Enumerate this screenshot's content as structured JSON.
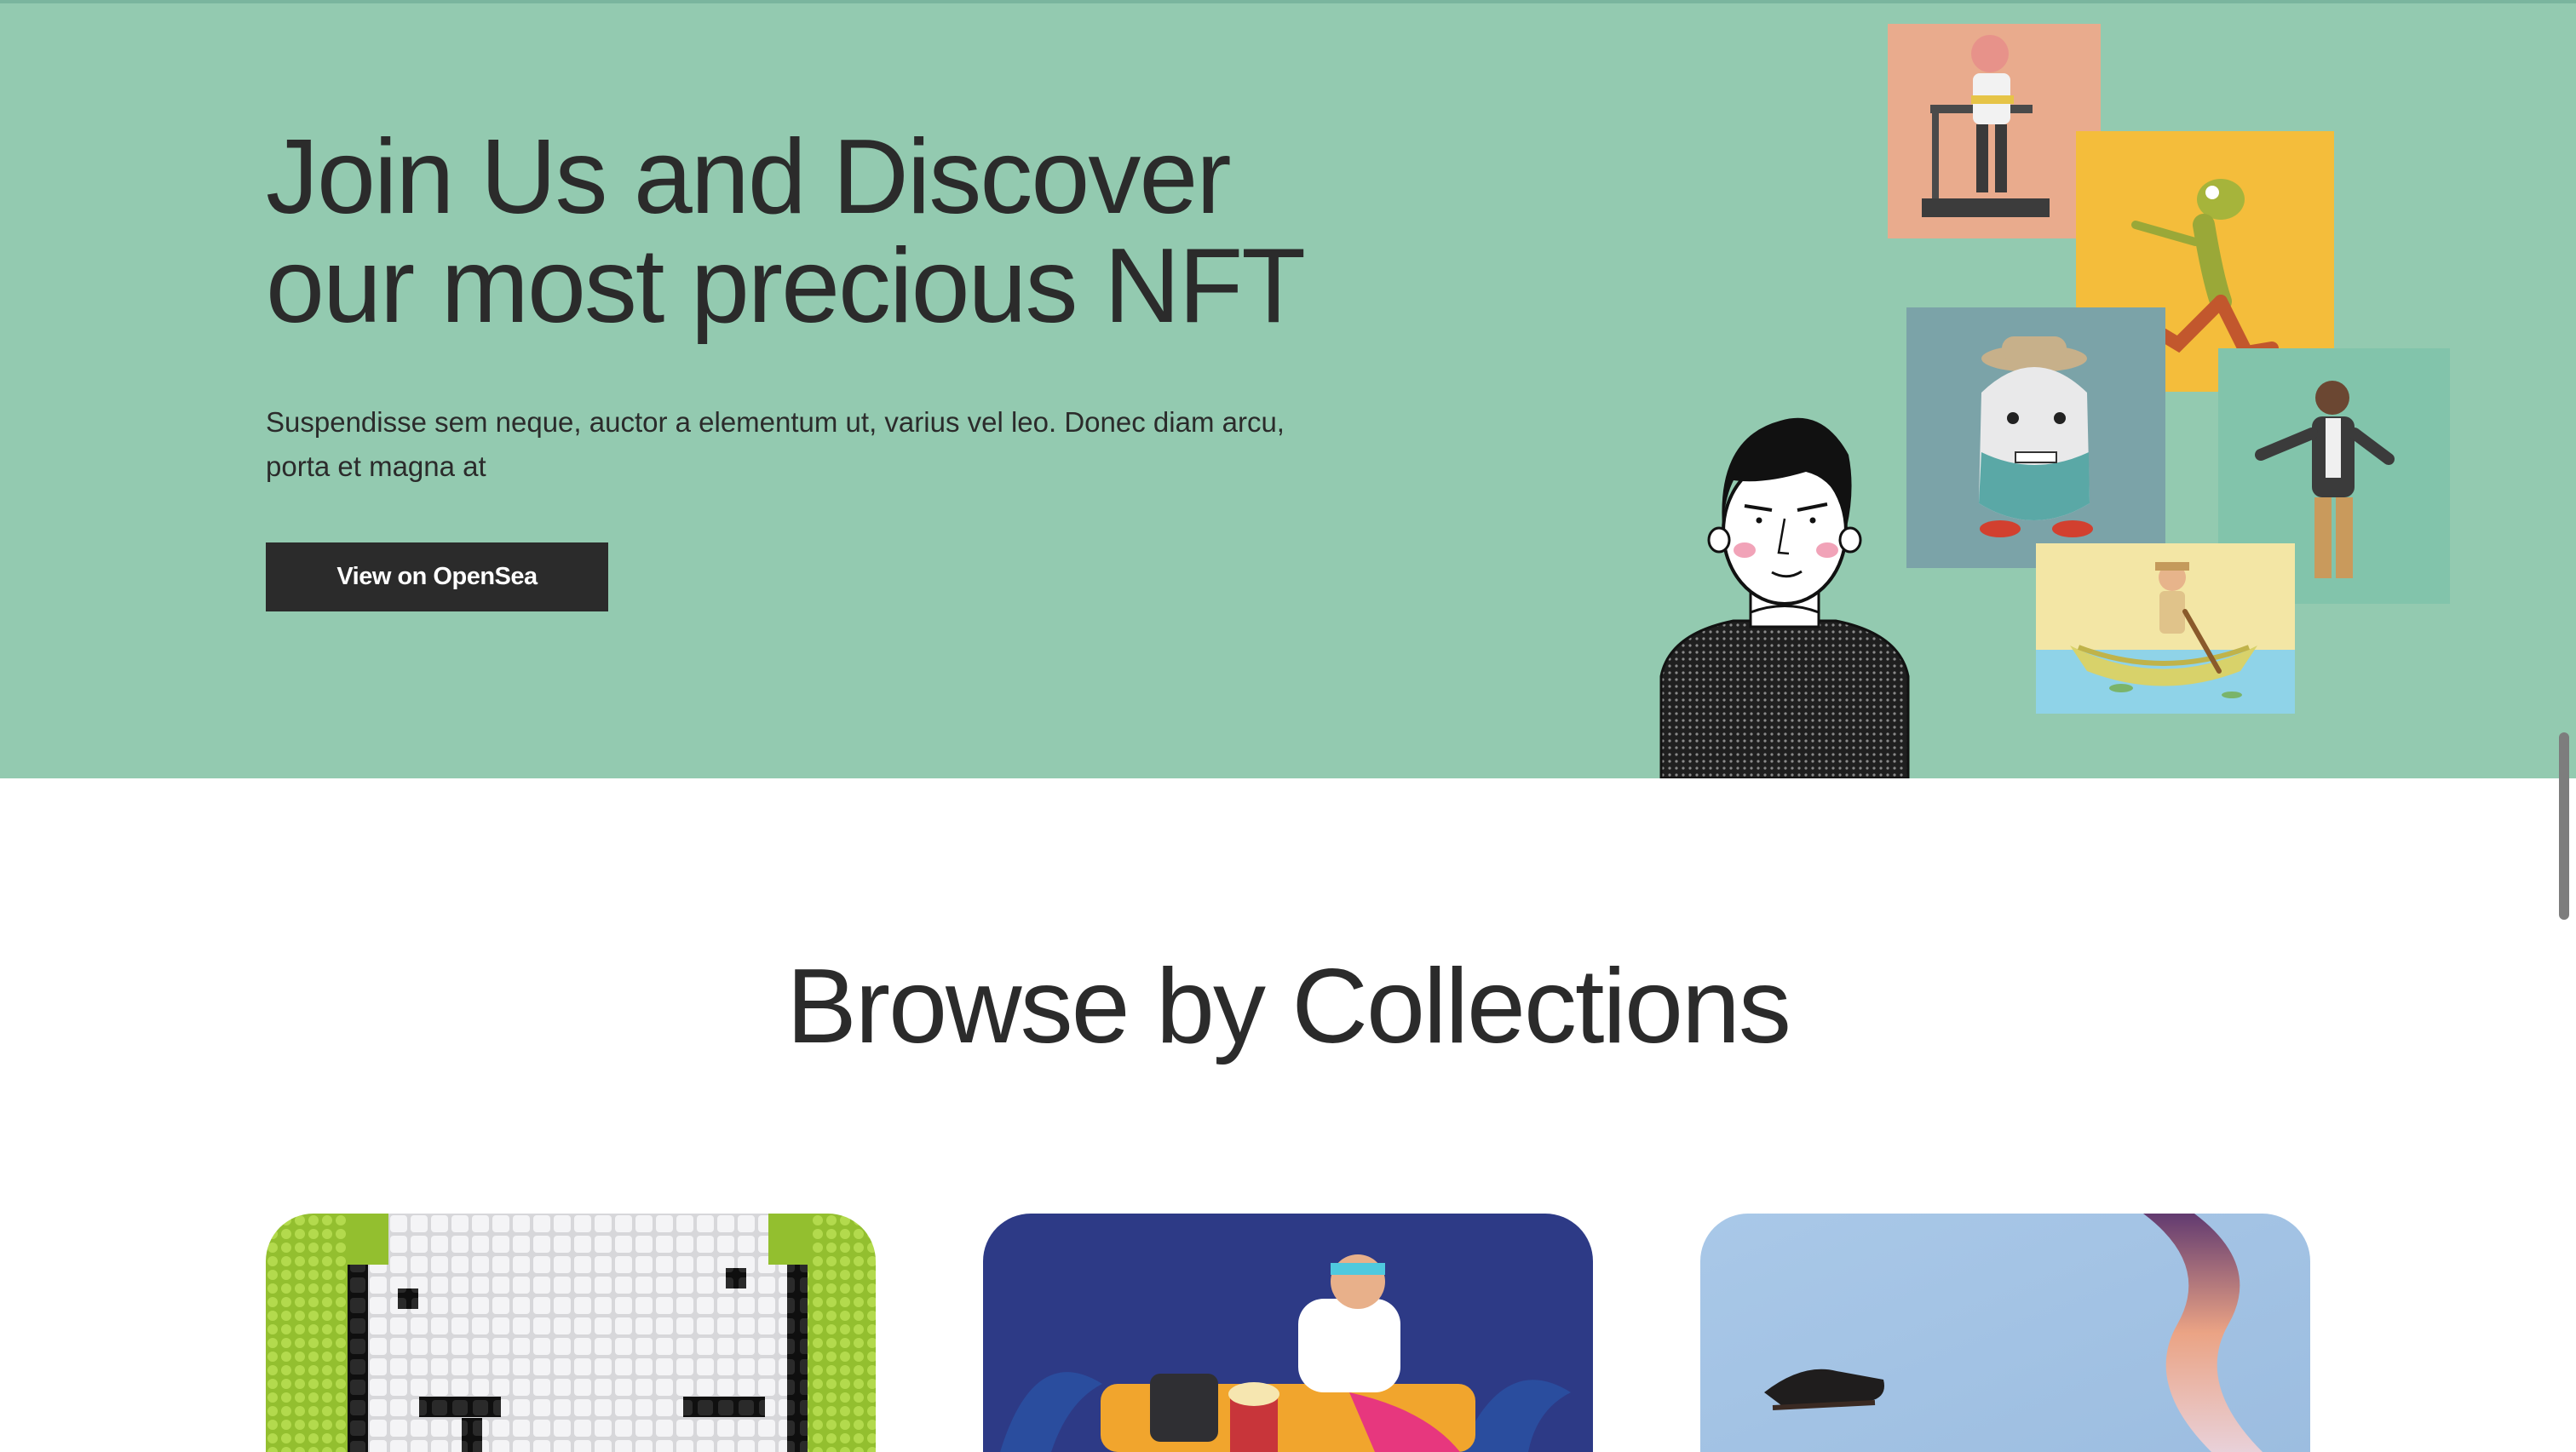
{
  "hero": {
    "title_line1": "Join Us and Discover",
    "title_line2": "our most precious NFT",
    "description_line1": "Suspendisse sem neque, auctor a elementum ut, varius vel leo. Donec diam arcu,",
    "description_line2": "porta et magna at",
    "cta_label": "View on OpenSea",
    "background_color": "#93cab0"
  },
  "collections": {
    "title": "Browse by Collections",
    "cards": [
      {
        "theme": "pixel-art-face",
        "color": "#9bc63e"
      },
      {
        "theme": "3d-character-on-sofa",
        "color": "#2d3a86"
      },
      {
        "theme": "floating-boots-abstract",
        "color": "#9ebfe0"
      }
    ]
  },
  "colors": {
    "text": "#2b2b2b",
    "button": "#2b2b2b",
    "button_text": "#ffffff"
  }
}
